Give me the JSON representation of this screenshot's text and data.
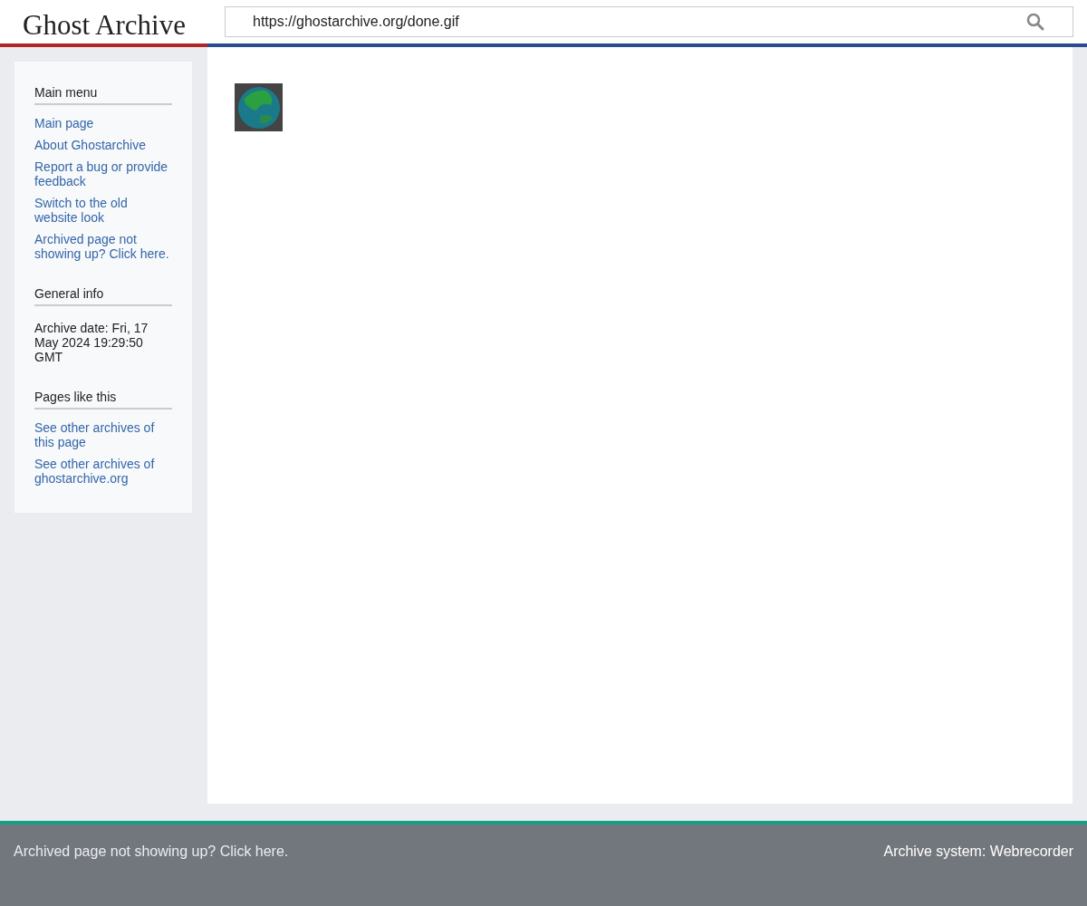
{
  "header": {
    "logo": "Ghost Archive",
    "search": {
      "value": "https://ghostarchive.org/done.gif"
    }
  },
  "sidebar": {
    "sections": [
      {
        "title": "Main menu",
        "items": [
          {
            "kind": "link",
            "text": "Main page"
          },
          {
            "kind": "link",
            "text": "About Ghostarchive"
          },
          {
            "kind": "link",
            "text": "Report a bug or provide feedback"
          },
          {
            "kind": "link",
            "text": "Switch to the old website look"
          },
          {
            "kind": "link",
            "text": "Archived page not showing up? Click here."
          }
        ]
      },
      {
        "title": "General info",
        "items": [
          {
            "kind": "text",
            "text": "Archive date: Fri, 17 May 2024 19:29:50 GMT"
          }
        ]
      },
      {
        "title": "Pages like this",
        "items": [
          {
            "kind": "link",
            "text": "See other archives of this page"
          },
          {
            "kind": "link",
            "text": "See other archives of ghostarchive.org"
          }
        ]
      }
    ]
  },
  "footer": {
    "left": "Archived page not showing up? Click here.",
    "right": "Archive system: Webrecorder"
  }
}
